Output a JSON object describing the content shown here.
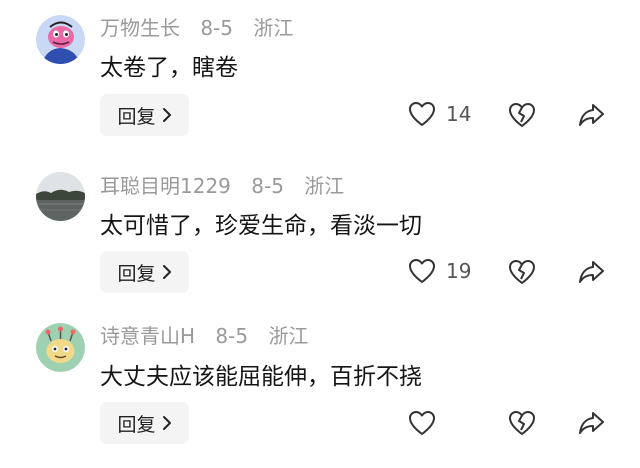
{
  "comments": [
    {
      "username": "万物生长",
      "date": "8-5",
      "location": "浙江",
      "text": "太卷了，瞎卷",
      "reply_label": "回复",
      "likes": "14",
      "avatar_icon": "pink-cartoon-avatar"
    },
    {
      "username": "耳聪目明1229",
      "date": "8-5",
      "location": "浙江",
      "text": "太可惜了，珍爱生命，看淡一切",
      "reply_label": "回复",
      "likes": "19",
      "avatar_icon": "landscape-photo-avatar"
    },
    {
      "username": "诗意青山H",
      "date": "8-5",
      "location": "浙江",
      "text": "大丈夫应该能屈能伸，百折不挠",
      "reply_label": "回复",
      "avatar_icon": "green-monster-avatar"
    }
  ],
  "colors": {
    "meta_text": "#9a9a9a",
    "body_text": "#151515",
    "reply_bg": "#f4f4f4",
    "icon_stroke": "#333333"
  }
}
